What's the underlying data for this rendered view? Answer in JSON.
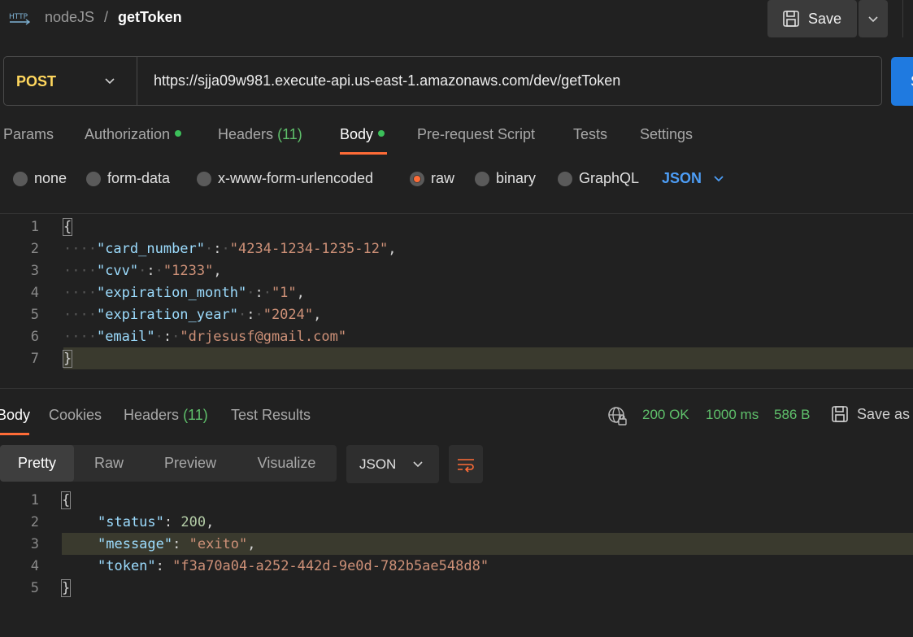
{
  "header": {
    "icon": "http-icon",
    "breadcrumb_parent": "nodeJS",
    "breadcrumb_sep": "/",
    "breadcrumb_current": "getToken",
    "save_label": "Save"
  },
  "request": {
    "method": "POST",
    "url": "https://sjja09w981.execute-api.us-east-1.amazonaws.com/dev/getToken",
    "send_label": "S"
  },
  "request_tabs": {
    "params": "Params",
    "authorization": "Authorization",
    "headers": "Headers",
    "headers_count": "(11)",
    "body": "Body",
    "prerequest": "Pre-request Script",
    "tests": "Tests",
    "settings": "Settings"
  },
  "body_types": {
    "none": "none",
    "form_data": "form-data",
    "urlencoded": "x-www-form-urlencoded",
    "raw": "raw",
    "binary": "binary",
    "graphql": "GraphQL",
    "language": "JSON"
  },
  "request_body": {
    "line_numbers": [
      "1",
      "2",
      "3",
      "4",
      "5",
      "6",
      "7"
    ],
    "open": "{",
    "close": "}",
    "fields": [
      {
        "key": "\"card_number\"",
        "value": "\"4234-1234-1235-12\"",
        "comma": ","
      },
      {
        "key": "\"cvv\"",
        "value": "\"1233\"",
        "comma": ","
      },
      {
        "key": "\"expiration_month\"",
        "value": "\"1\"",
        "comma": ","
      },
      {
        "key": "\"expiration_year\"",
        "value": "\"2024\"",
        "comma": ","
      },
      {
        "key": "\"email\"",
        "value": "\"drjesusf@gmail.com\"",
        "comma": ""
      }
    ]
  },
  "response_tabs": {
    "body": "Body",
    "cookies": "Cookies",
    "headers": "Headers",
    "headers_count": "(11)",
    "test_results": "Test Results"
  },
  "response_status": {
    "status": "200 OK",
    "time": "1000 ms",
    "size": "586 B",
    "save_as": "Save as"
  },
  "response_view": {
    "pretty": "Pretty",
    "raw": "Raw",
    "preview": "Preview",
    "visualize": "Visualize",
    "format": "JSON"
  },
  "response_body": {
    "line_numbers": [
      "1",
      "2",
      "3",
      "4",
      "5"
    ],
    "open": "{",
    "close": "}",
    "status_key": "\"status\"",
    "status_val": "200",
    "message_key": "\"message\"",
    "message_val": "\"exito\"",
    "token_key": "\"token\"",
    "token_val": "\"f3a70a04-a252-442d-9e0d-782b5ae548d8\""
  },
  "colors": {
    "accent": "#ff6c37",
    "method": "#ffd75e",
    "success": "#5fc06b",
    "link": "#4d9df5"
  }
}
